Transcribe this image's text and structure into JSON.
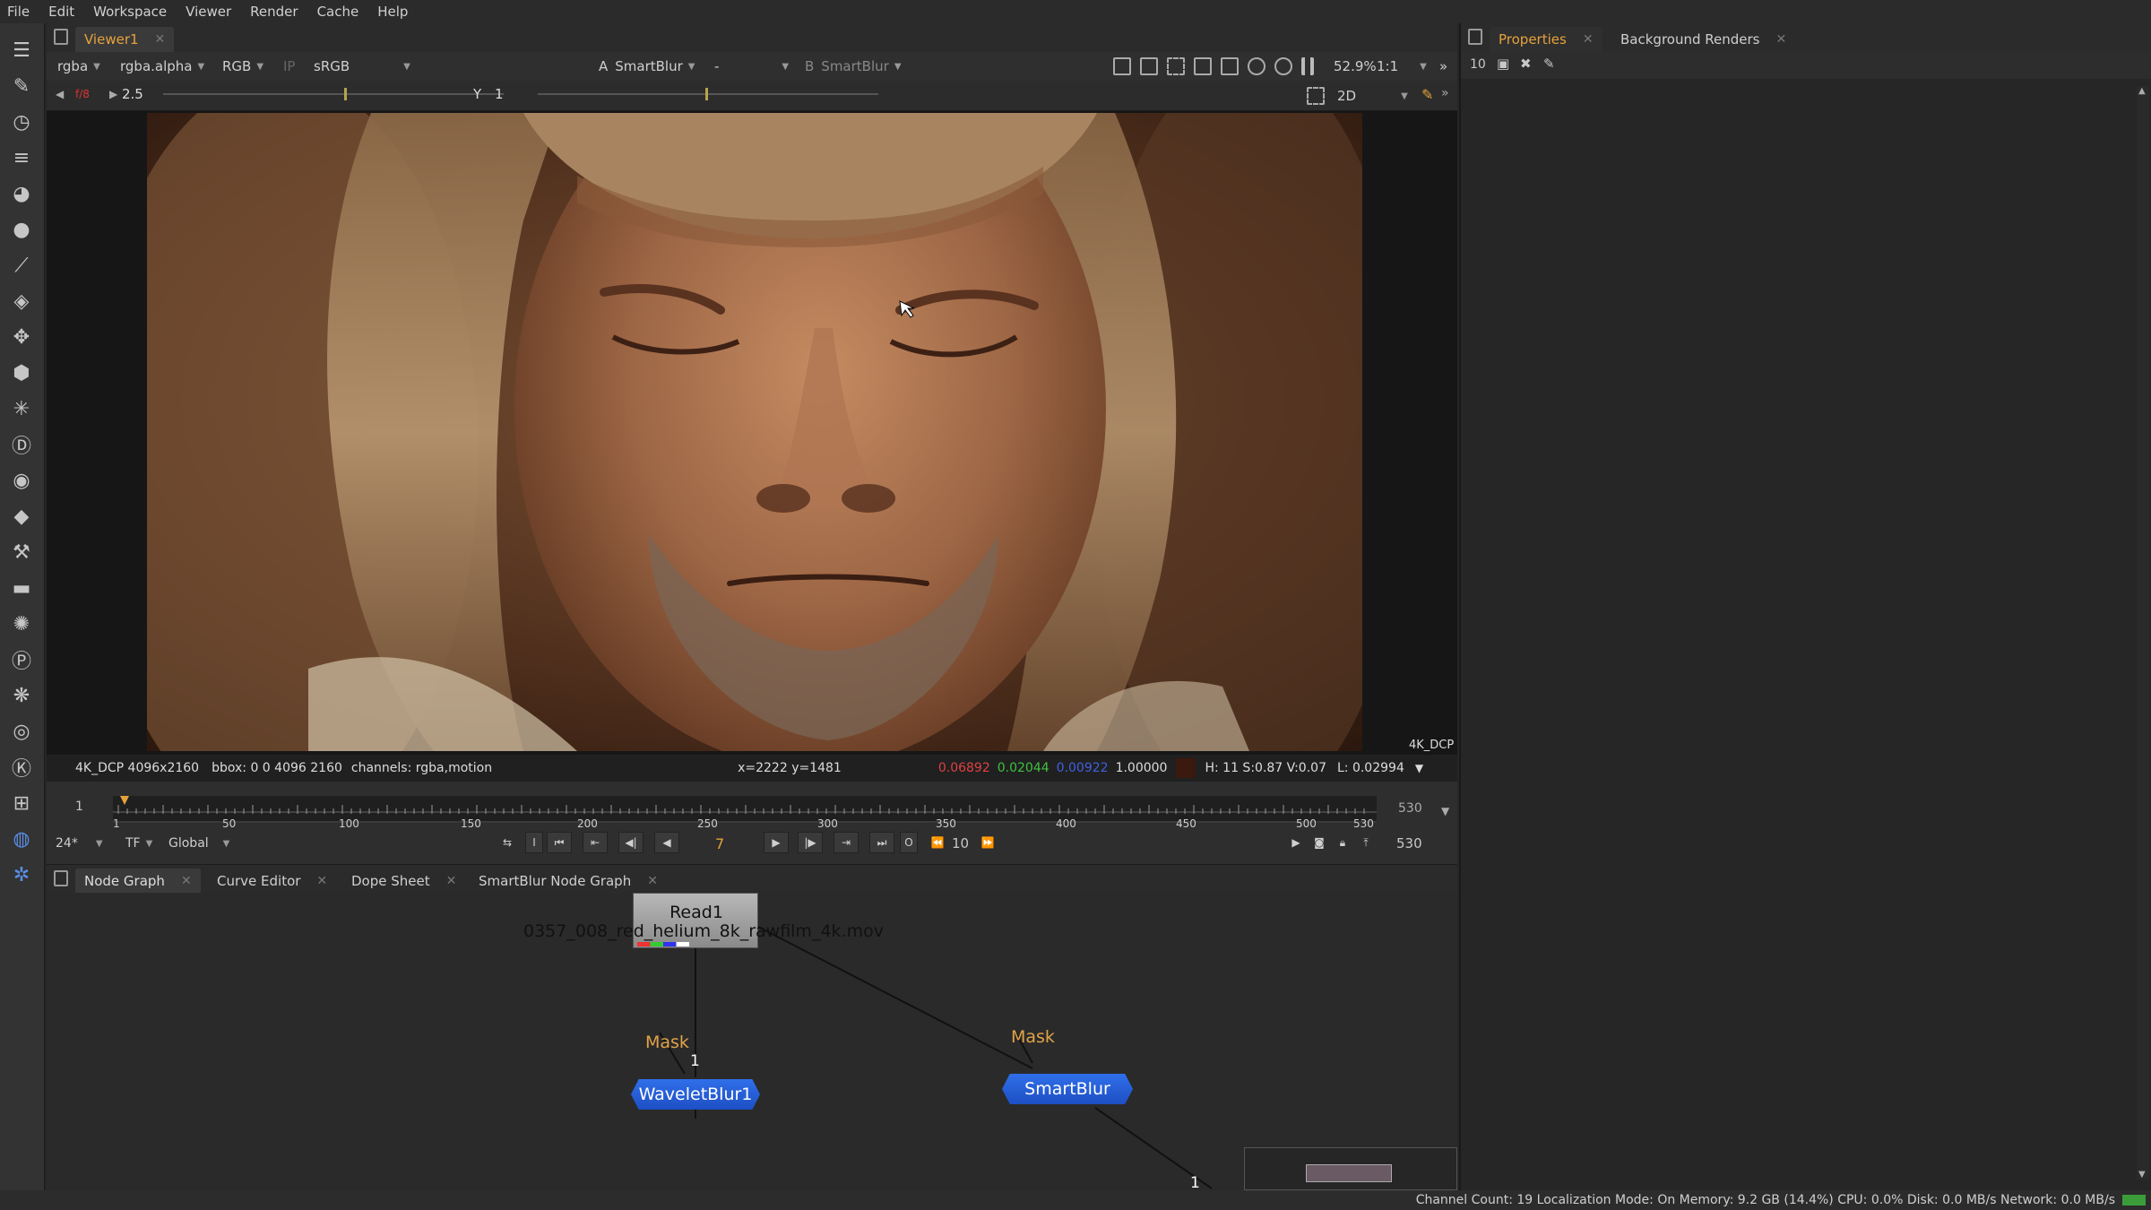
{
  "menu": [
    "File",
    "Edit",
    "Workspace",
    "Viewer",
    "Render",
    "Cache",
    "Help"
  ],
  "viewer": {
    "tab": "Viewer1",
    "channels": "rgba",
    "alpha_channel": "rgba.alpha",
    "color_space": "RGB",
    "ip_label": "IP",
    "lut": "sRGB",
    "a_label": "A",
    "a_input": "SmartBlur",
    "compare_mode": "-",
    "b_label": "B",
    "b_input": "SmartBlur",
    "zoom": "52.9%",
    "ratio": "1:1",
    "gain_label": "f/8",
    "gain_value": "2.5",
    "gamma_label": "Y",
    "gamma_value": "1",
    "view_mode": "2D",
    "format_label": "4K_DCP"
  },
  "info": {
    "format": "4K_DCP 4096x2160",
    "bbox": "bbox: 0 0 4096 2160",
    "channels": "channels: rgba,motion",
    "coords": "x=2222 y=1481",
    "r": "0.06892",
    "g": "0.02044",
    "b": "0.00922",
    "a": "1.00000",
    "hsv": "H: 11 S:0.87 V:0.07",
    "lum": "L: 0.02994",
    "swatch_color": "#3a1a0e"
  },
  "timeline": {
    "start_frame": "1",
    "end_frame": "530",
    "current_frame": "7",
    "out_frame": "530",
    "step": "10",
    "fps": "24*",
    "tf": "TF",
    "range_mode": "Global",
    "ticks": [
      "1",
      "50",
      "100",
      "150",
      "200",
      "250",
      "300",
      "350",
      "400",
      "450",
      "500",
      "530"
    ]
  },
  "node_graph_tabs": [
    "Node Graph",
    "Curve Editor",
    "Dope Sheet",
    "SmartBlur Node Graph"
  ],
  "nodes": {
    "read_name": "Read1",
    "read_file": "0357_008_red_helium_8k_rawfilm_4k.mov",
    "wavelet": "WaveletBlur1",
    "smartblur": "SmartBlur",
    "mask_label": "Mask",
    "input_num": "1",
    "input_num_2": "1"
  },
  "right_tabs": [
    "Properties",
    "Background Renders"
  ],
  "right_max_panels": "10",
  "status": "Channel Count: 19  Localization Mode: On  Memory: 9.2 GB (14.4%)  CPU: 0.0%  Disk: 0.0 MB/s  Network: 0.0 MB/s",
  "colors": {
    "accent": "#e6a33b",
    "node_blue": "#2b63d9",
    "red_value": "#e04040",
    "green_value": "#40c040",
    "blue_value": "#4060e0"
  }
}
